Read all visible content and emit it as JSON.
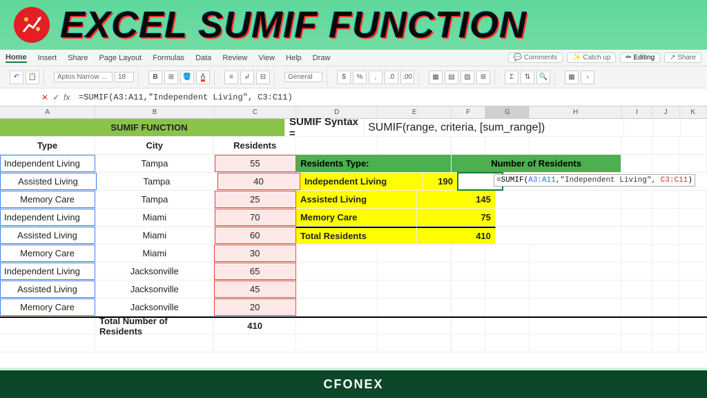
{
  "banner": {
    "title": "EXCEL SUMIF FUNCTION"
  },
  "ribbon": {
    "tabs": [
      "Home",
      "Insert",
      "Share",
      "Page Layout",
      "Formulas",
      "Data",
      "Review",
      "View",
      "Help",
      "Draw"
    ],
    "buttons": {
      "comments": "💬 Comments",
      "catchup": "✨ Catch up",
      "editing": "✏ Editing",
      "share": "↗ Share"
    },
    "font": "Aptos Narrow ...",
    "size": "18",
    "general": "General"
  },
  "formulaBar": {
    "name": "",
    "fx": "fx",
    "formula": "=SUMIF(A3:A11,\"Independent Living\", C3:C11)"
  },
  "columns": [
    "A",
    "B",
    "C",
    "D",
    "E",
    "F",
    "G",
    "H",
    "I",
    "J",
    "K"
  ],
  "sheet": {
    "title": "SUMIF FUNCTION",
    "headers": [
      "Type",
      "City",
      "Residents"
    ],
    "rows": [
      {
        "type": "Independent Living",
        "city": "Tampa",
        "res": "55"
      },
      {
        "type": "Assisted Living",
        "city": "Tampa",
        "res": "40"
      },
      {
        "type": "Memory Care",
        "city": "Tampa",
        "res": "25"
      },
      {
        "type": "Independent Living",
        "city": "Miami",
        "res": "70"
      },
      {
        "type": "Assisted Living",
        "city": "Miami",
        "res": "60"
      },
      {
        "type": "Memory Care",
        "city": "Miami",
        "res": "30"
      },
      {
        "type": "Independent Living",
        "city": "Jacksonville",
        "res": "65"
      },
      {
        "type": "Assisted Living",
        "city": "Jacksonville",
        "res": "45"
      },
      {
        "type": "Memory Care",
        "city": "Jacksonville",
        "res": "20"
      }
    ],
    "totalLabel": "Total Number of Residents",
    "totalValue": "410"
  },
  "syntax": {
    "label": "SUMIF Syntax =",
    "text": "SUMIF(range, criteria, [sum_range])"
  },
  "summary": {
    "h1": "Residents Type:",
    "h2": "Number of Residents",
    "rows": [
      {
        "label": "Independent Living",
        "val": "190"
      },
      {
        "label": "Assisted Living",
        "val": "145"
      },
      {
        "label": "Memory Care",
        "val": "75"
      }
    ],
    "totalLabel": "Total Residents",
    "totalVal": "410"
  },
  "floating": {
    "prefix": "=SUMIF(",
    "ref1": "A3:A11",
    "mid": ",\"Independent Living\", ",
    "ref2": "C3:C11",
    "suffix": ")"
  },
  "footer": "CFONEX"
}
